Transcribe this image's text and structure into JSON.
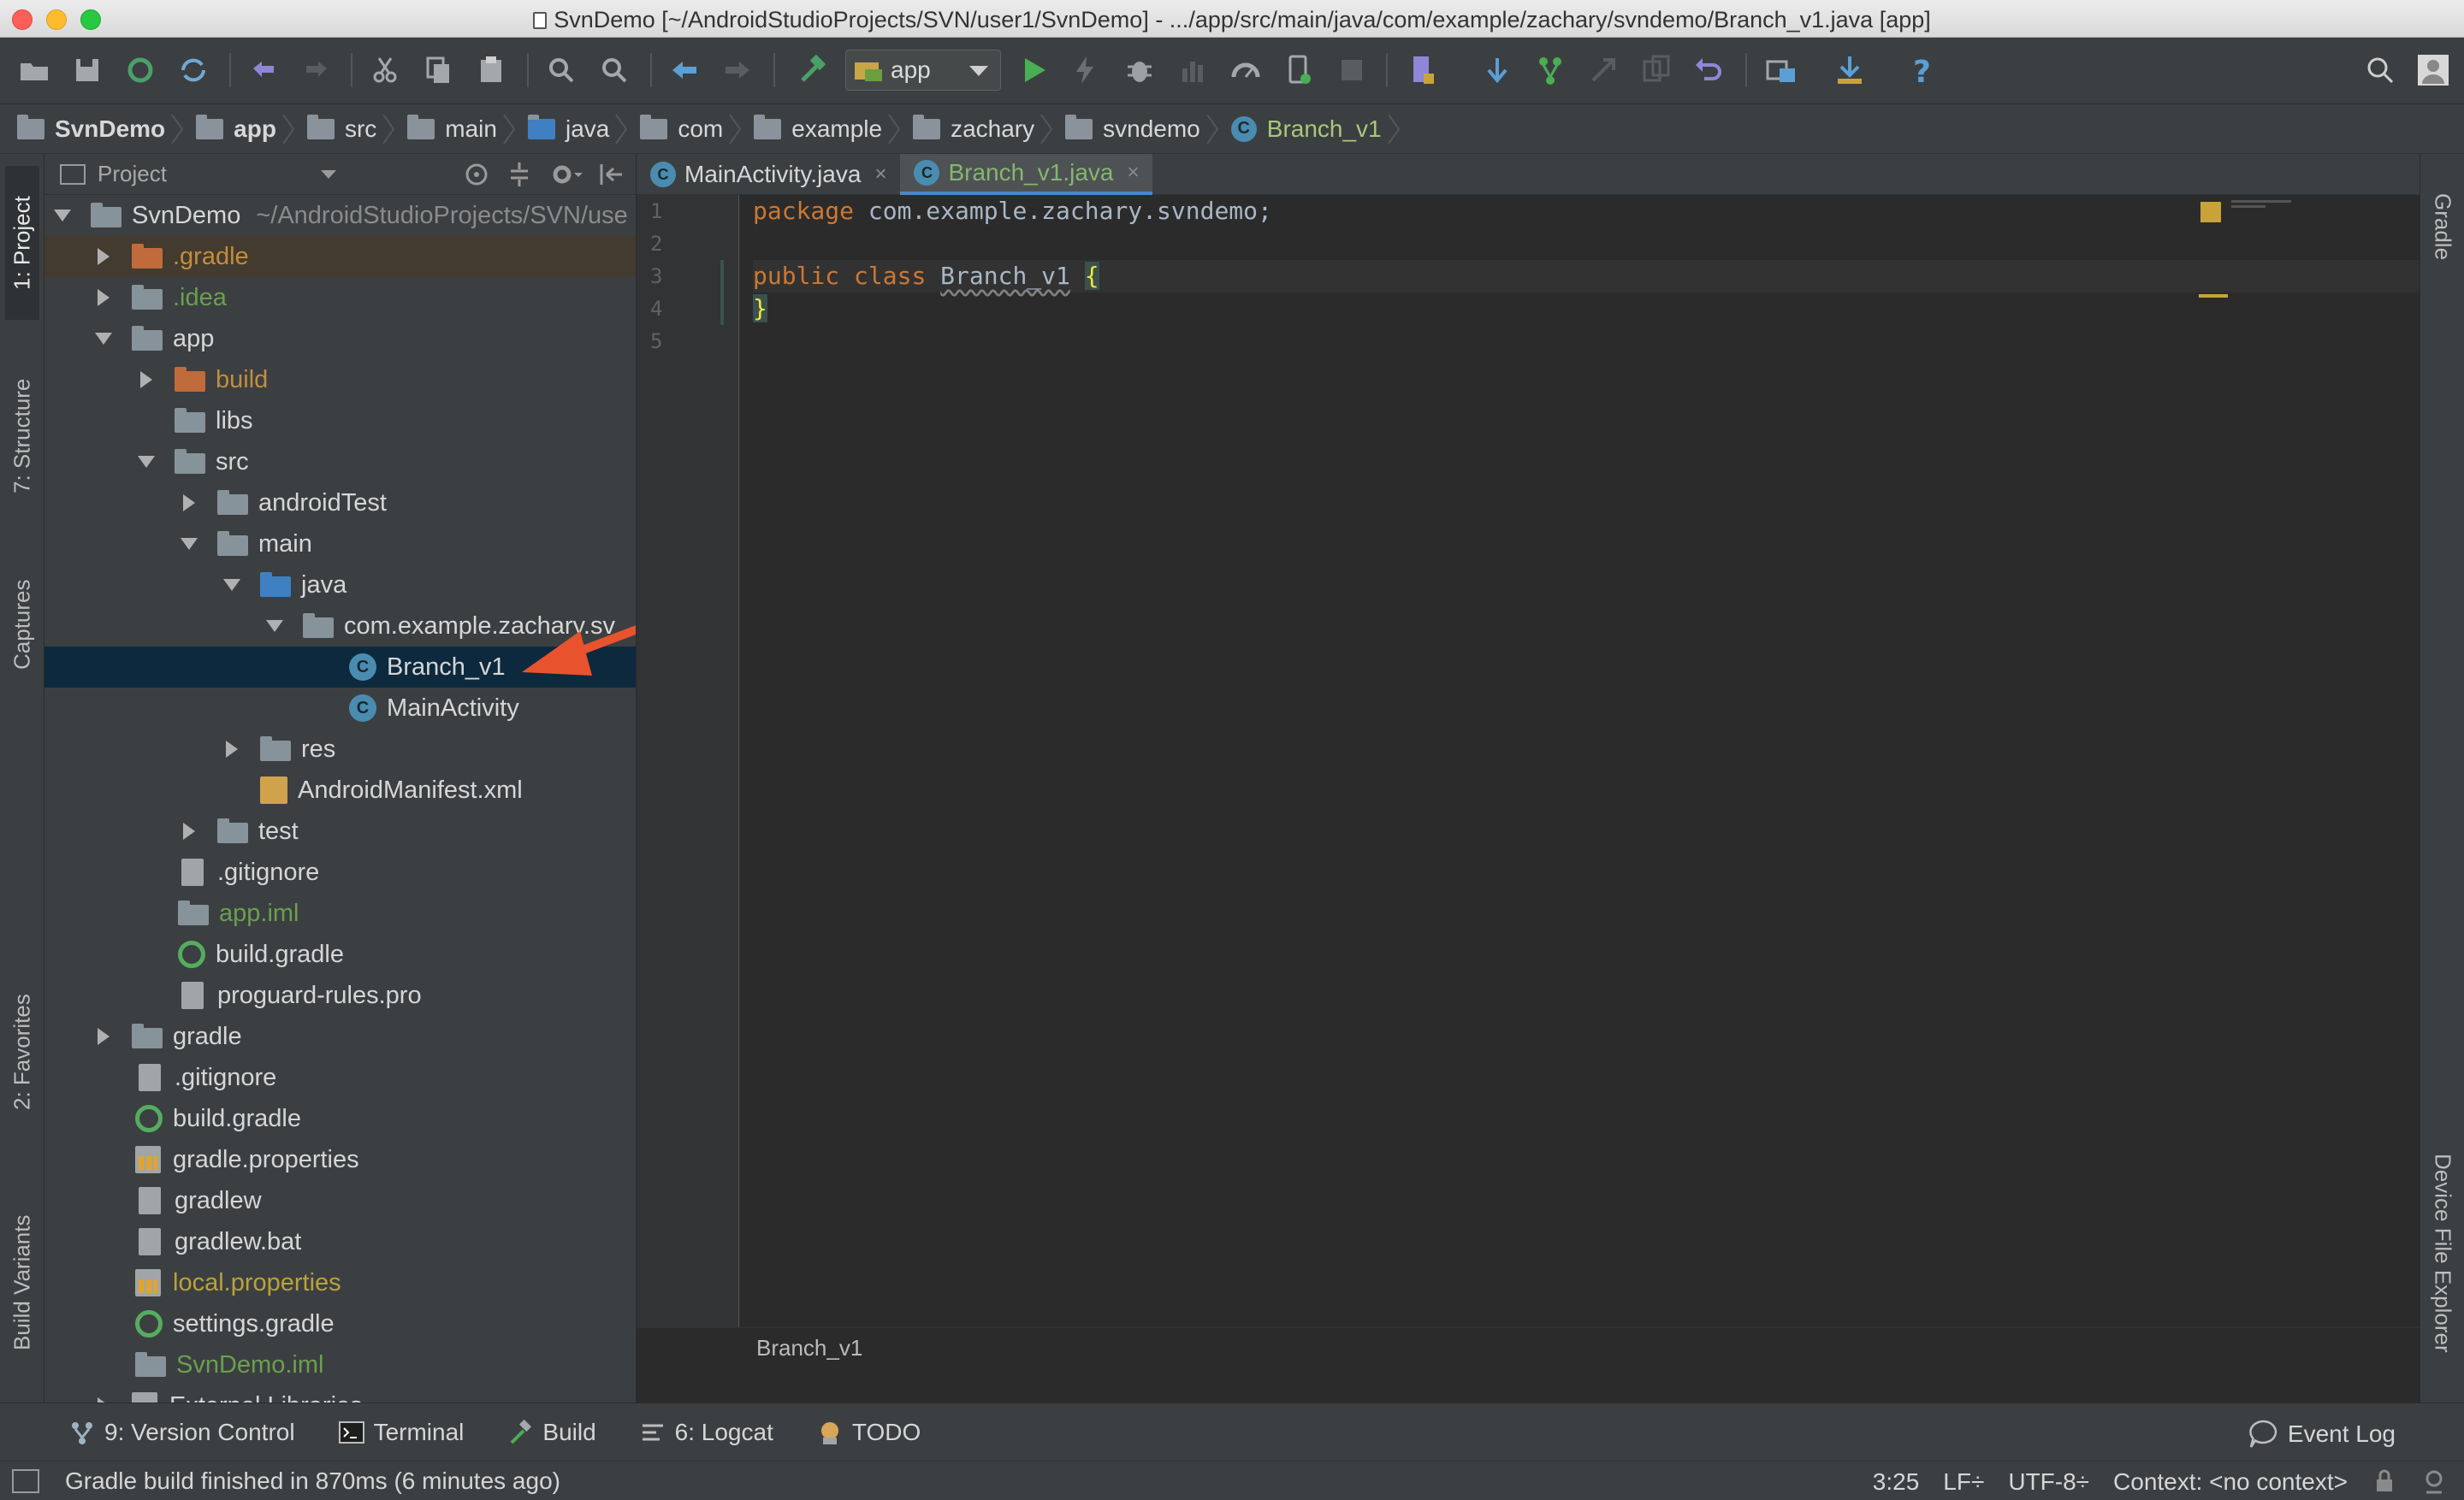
{
  "window": {
    "title": "SvnDemo [~/AndroidStudioProjects/SVN/user1/SvnDemo] - .../app/src/main/java/com/example/zachary/svndemo/Branch_v1.java [app]"
  },
  "toolbar": {
    "run_config": "app"
  },
  "breadcrumbs": [
    "SvnDemo",
    "app",
    "src",
    "main",
    "java",
    "com",
    "example",
    "zachary",
    "svndemo",
    "Branch_v1"
  ],
  "left_tabs": {
    "project": "1: Project",
    "structure": "7: Structure",
    "captures": "Captures",
    "favorites": "2: Favorites",
    "build_variants": "Build Variants"
  },
  "right_tabs": {
    "gradle": "Gradle",
    "device_file_explorer": "Device File Explorer"
  },
  "project_panel": {
    "view_label": "Project",
    "tree": [
      {
        "label": "SvnDemo",
        "path": "~/AndroidStudioProjects/SVN/use"
      },
      {
        "label": ".gradle"
      },
      {
        "label": ".idea"
      },
      {
        "label": "app"
      },
      {
        "label": "build"
      },
      {
        "label": "libs"
      },
      {
        "label": "src"
      },
      {
        "label": "androidTest"
      },
      {
        "label": "main"
      },
      {
        "label": "java"
      },
      {
        "label": "com.example.zachary.sv"
      },
      {
        "label": "Branch_v1"
      },
      {
        "label": "MainActivity"
      },
      {
        "label": "res"
      },
      {
        "label": "AndroidManifest.xml"
      },
      {
        "label": "test"
      },
      {
        "label": ".gitignore"
      },
      {
        "label": "app.iml"
      },
      {
        "label": "build.gradle"
      },
      {
        "label": "proguard-rules.pro"
      },
      {
        "label": "gradle"
      },
      {
        "label": ".gitignore"
      },
      {
        "label": "build.gradle"
      },
      {
        "label": "gradle.properties"
      },
      {
        "label": "gradlew"
      },
      {
        "label": "gradlew.bat"
      },
      {
        "label": "local.properties"
      },
      {
        "label": "settings.gradle"
      },
      {
        "label": "SvnDemo.iml"
      },
      {
        "label": "External Libraries"
      }
    ]
  },
  "editor": {
    "tabs": [
      {
        "label": "MainActivity.java",
        "close": "×"
      },
      {
        "label": "Branch_v1.java",
        "close": "×"
      }
    ],
    "line_numbers": [
      "1",
      "2",
      "3",
      "4",
      "5"
    ],
    "code": {
      "l1_kw": "package",
      "l1_rest": " com.example.zachary.svndemo;",
      "l3_kw1": "public",
      "l3_kw2": "class",
      "l3_name": "Branch_v1",
      "l3_brace": "{",
      "l4_brace": "}"
    },
    "footer_breadcrumb": "Branch_v1"
  },
  "bottom_tools": [
    {
      "label": "9: Version Control"
    },
    {
      "label": "Terminal"
    },
    {
      "label": "Build"
    },
    {
      "label": "6: Logcat"
    },
    {
      "label": "TODO"
    }
  ],
  "event_log": "Event Log",
  "status": {
    "message": "Gradle build finished in 870ms (6 minutes ago)",
    "position": "3:25",
    "line_sep": "LF÷",
    "encoding": "UTF-8÷",
    "context": "Context: <no context>"
  },
  "colors": {
    "accent_blue": "#4a88c7",
    "selection": "#0d293e",
    "annotation_arrow": "#e8532d",
    "keyword": "#cc7832"
  }
}
